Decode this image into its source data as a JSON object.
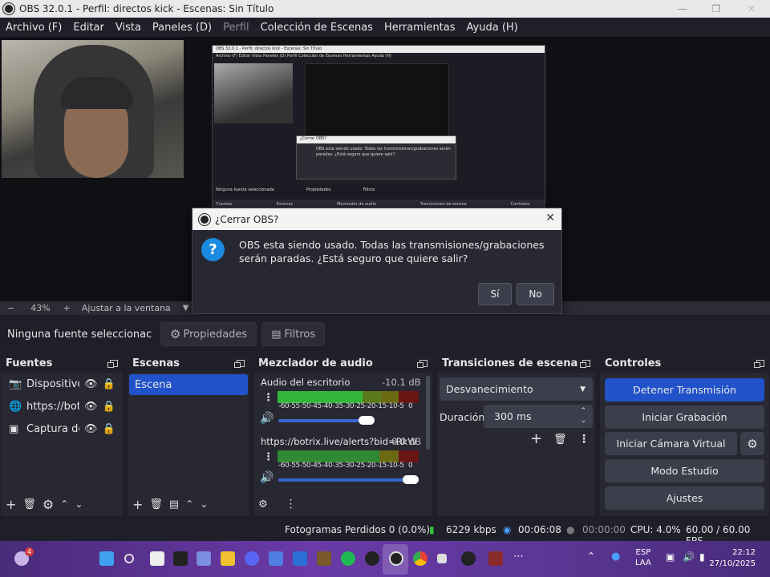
{
  "window": {
    "title": "OBS 32.0.1 - Perfil: directos kick - Escenas: Sin Título"
  },
  "menu": [
    "Archivo (F)",
    "Editar",
    "Vista",
    "Paneles (D)",
    "Perfil",
    "Colección de Escenas",
    "Herramientas",
    "Ayuda (H)"
  ],
  "zoom": {
    "value": "43%",
    "fit_label": "Ajustar a la ventana"
  },
  "dialog": {
    "title": "¿Cerrar OBS?",
    "message": "OBS esta siendo usado. Todas las transmisiones/grabaciones serán paradas. ¿Está seguro que quiere salir?",
    "yes": "Sí",
    "no": "No"
  },
  "nested_preview": {
    "title": "OBS 32.0.1 - Perfil: directos kick - Escenas: Sin Título",
    "menu": "Archivo (F)   Editar   Vista   Paneles (D)   Perfil   Colección de Escenas   Herramientas   Ayuda (H)",
    "dialog_title": "¿Cerrar OBS?",
    "dialog_msg": "OBS esta siendo usado. Todas las transmisiones/grabaciones serán paradas. ¿Está seguro que quiere salir?",
    "no_source": "Ninguna fuente seleccionada",
    "props": "Propiedades",
    "filters": "Filtros",
    "docks": [
      "Fuentes",
      "Escenas",
      "Mezclador de audio",
      "Transiciones de escena",
      "Controles"
    ]
  },
  "source_toolbar": {
    "no_source": "Ninguna fuente seleccionac",
    "properties": "Propiedades",
    "filters": "Filtros"
  },
  "sources": {
    "title": "Fuentes",
    "items": [
      {
        "name": "Dispositivo d",
        "icon": "camera-icon"
      },
      {
        "name": "https://botr",
        "icon": "globe-icon"
      },
      {
        "name": "Captura de p",
        "icon": "monitor-icon"
      }
    ]
  },
  "scenes": {
    "title": "Escenas",
    "items": [
      "Escena"
    ]
  },
  "mixer": {
    "title": "Mezclador de audio",
    "channels": [
      {
        "name": "Audio del escritorio",
        "db": "-10.1 dB",
        "volume": 0.87
      },
      {
        "name": "https://botrix.live/alerts?bid=RkW",
        "db": "0.0 dB",
        "volume": 1.0
      }
    ],
    "ticks": [
      "-60",
      "-55",
      "-50",
      "-45",
      "-40",
      "-35",
      "-30",
      "-25",
      "-20",
      "-15",
      "-10",
      "-5",
      "0"
    ]
  },
  "transitions": {
    "title": "Transiciones de escena",
    "selected": "Desvanecimiento",
    "duration_label": "Duración",
    "duration": "300 ms"
  },
  "controls": {
    "title": "Controles",
    "buttons": [
      "Detener Transmisión",
      "Iniciar Grabación",
      "Iniciar Cámara Virtual",
      "Modo Estudio",
      "Ajustes"
    ],
    "accent": "#2152c9"
  },
  "status": {
    "dropped": "Fotogramas Perdidos 0 (0.0%)",
    "bitrate": "6229 kbps",
    "stream_time": "00:06:08",
    "rec_time": "00:00:00",
    "cpu": "CPU: 4.0%",
    "fps": "60.00 / 60.00 FPS"
  },
  "taskbar": {
    "badge": "4",
    "lang": "ESP",
    "lang2": "LAA",
    "time": "22:12",
    "date": "27/10/2025"
  }
}
